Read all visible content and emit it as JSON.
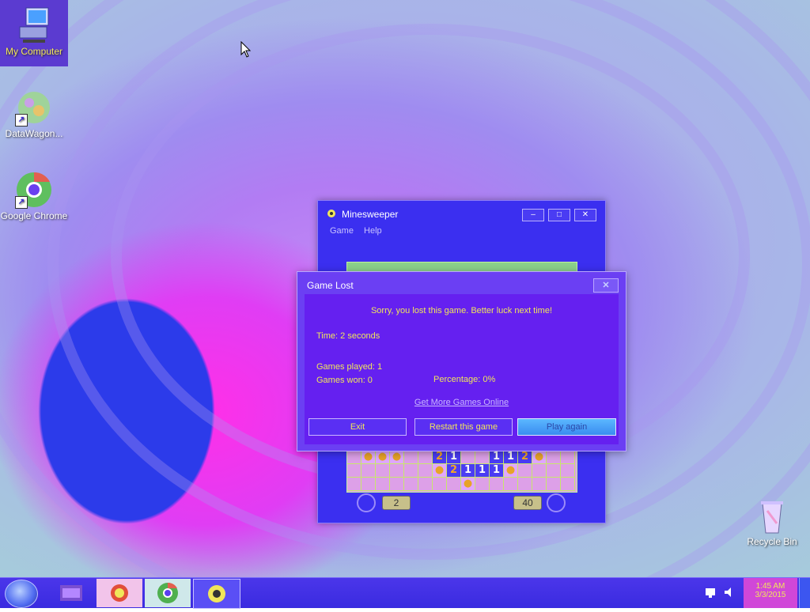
{
  "desktop": {
    "icons": [
      {
        "label": "My Computer",
        "icon": "computer-icon"
      },
      {
        "label": "DataWagon...",
        "icon": "datawagon-icon"
      },
      {
        "label": "Google Chrome",
        "icon": "chrome-icon"
      },
      {
        "label": "Recycle Bin",
        "icon": "recycle-bin-icon"
      }
    ]
  },
  "minesweeper": {
    "title": "Minesweeper",
    "menu": [
      "Game",
      "Help"
    ],
    "timer_value": "2",
    "mines_value": "40",
    "window_buttons": {
      "minimize": "–",
      "maximize": "□",
      "close": "✕"
    },
    "row1": [
      " ",
      "●",
      "●",
      "●",
      " ",
      " ",
      "2",
      "1",
      " ",
      " ",
      "1",
      "1",
      "2",
      "●",
      " ",
      " "
    ],
    "row2": [
      " ",
      " ",
      " ",
      " ",
      " ",
      " ",
      "●",
      "2",
      "1",
      "1",
      "1",
      "●",
      " ",
      " ",
      " ",
      " "
    ],
    "row3": [
      " ",
      " ",
      " ",
      " ",
      " ",
      " ",
      " ",
      " ",
      "●",
      " ",
      " ",
      " ",
      " ",
      " ",
      " ",
      " "
    ]
  },
  "dialog": {
    "title": "Game Lost",
    "close_label": "✕",
    "message": "Sorry, you lost this game. Better luck next time!",
    "time": "Time: 2 seconds",
    "games_played": "Games played: 1",
    "games_won": "Games won: 0",
    "percentage": "Percentage: 0%",
    "link": "Get More Games Online",
    "buttons": {
      "exit": "Exit",
      "restart": "Restart this game",
      "play_again": "Play again"
    }
  },
  "taskbar": {
    "clock_time": "1:45 AM",
    "clock_date": "3/3/2015"
  },
  "colors": {
    "window": "#3b2ff0",
    "dialog": "#6520f0",
    "text_accent": "#f0e65a",
    "taskbar": "#4b36ea"
  }
}
